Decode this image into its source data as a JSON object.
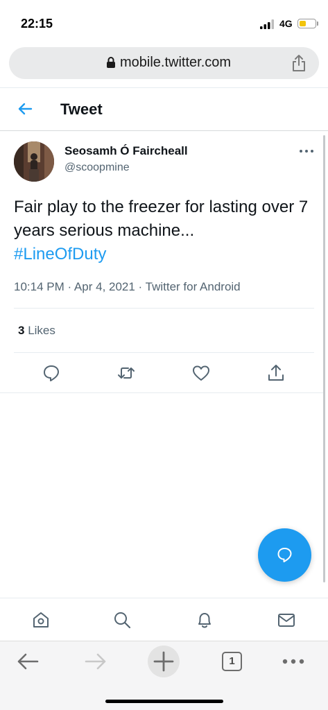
{
  "status": {
    "time": "22:15",
    "network": "4G"
  },
  "browser": {
    "url": "mobile.twitter.com",
    "tab_count": "1"
  },
  "header": {
    "title": "Tweet"
  },
  "tweet": {
    "author_name": "Seosamh Ó Faircheall",
    "handle": "@scoopmine",
    "text": "Fair play to the freezer for lasting over 7 years serious machine...",
    "hashtag": "#LineOfDuty",
    "timestamp": "10:14 PM · Apr 4, 2021 · Twitter for Android",
    "likes_count": "3",
    "likes_label": "Likes"
  },
  "colors": {
    "accent": "#1d9bf0",
    "text": "#0f1419",
    "secondary": "#536471"
  }
}
